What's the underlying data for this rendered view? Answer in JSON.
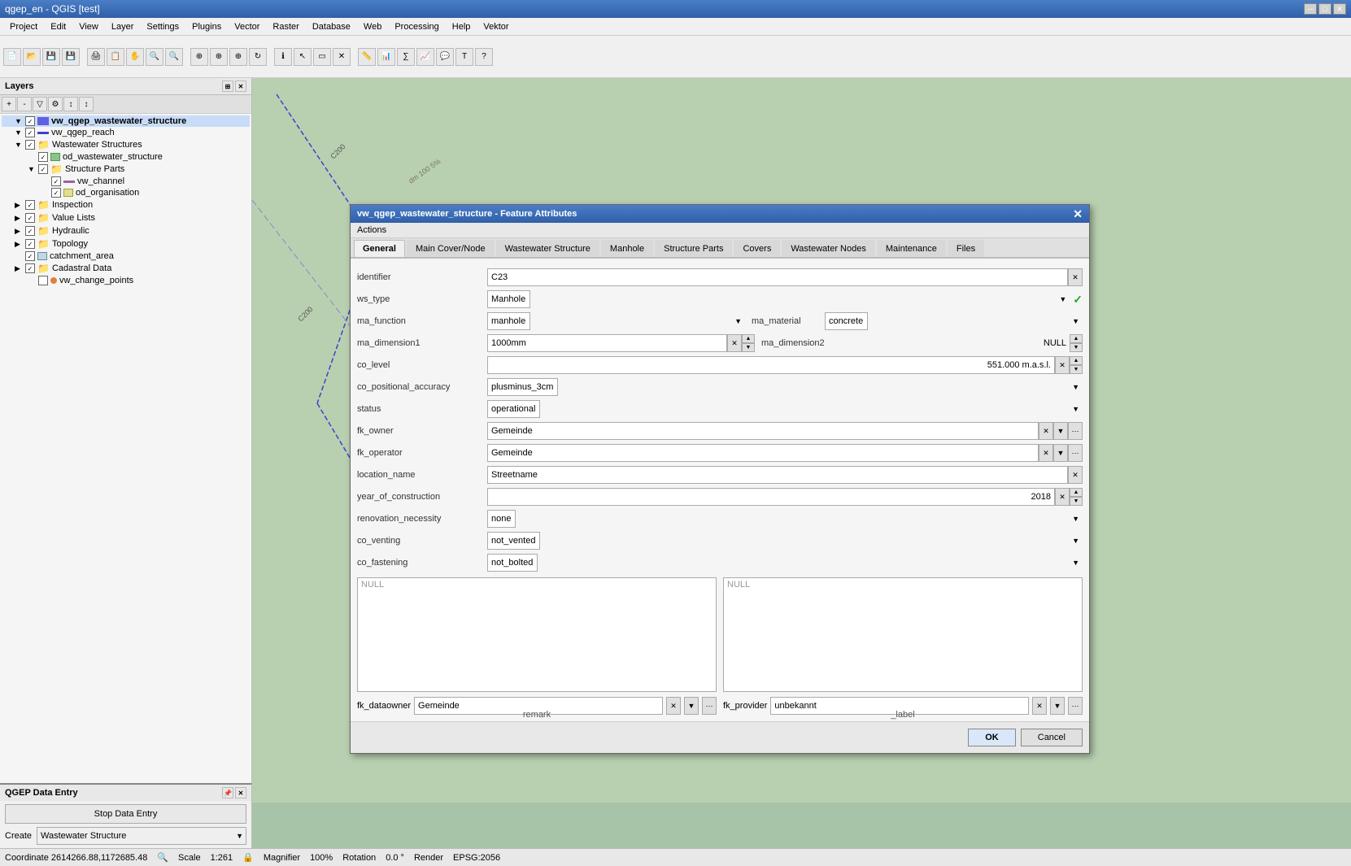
{
  "app": {
    "title": "qgep_en - QGIS [test]",
    "version": "QGIS"
  },
  "menu": {
    "items": [
      "Project",
      "Edit",
      "View",
      "Layer",
      "Settings",
      "Plugins",
      "Vector",
      "Raster",
      "Database",
      "Web",
      "Processing",
      "Help",
      "Vektor"
    ]
  },
  "layers_panel": {
    "title": "Layers",
    "items": [
      {
        "id": "vw_qgep_wastewater_structure",
        "label": "vw_qgep_wastewater_structure",
        "indent": 1,
        "checked": true,
        "bold": true
      },
      {
        "id": "vw_qgep_reach",
        "label": "vw_qgep_reach",
        "indent": 1,
        "checked": true
      },
      {
        "id": "wastewater_structures",
        "label": "Wastewater Structures",
        "indent": 1,
        "checked": true,
        "group": true
      },
      {
        "id": "od_wastewater_structure",
        "label": "od_wastewater_structure",
        "indent": 2,
        "checked": true
      },
      {
        "id": "structure_parts",
        "label": "Structure Parts",
        "indent": 2,
        "checked": true,
        "group": true
      },
      {
        "id": "vw_channel",
        "label": "vw_channel",
        "indent": 3,
        "checked": true
      },
      {
        "id": "od_organisation",
        "label": "od_organisation",
        "indent": 3,
        "checked": true
      },
      {
        "id": "inspection",
        "label": "Inspection",
        "indent": 1,
        "checked": true,
        "group": true
      },
      {
        "id": "value_lists",
        "label": "Value Lists",
        "indent": 1,
        "checked": true,
        "group": true
      },
      {
        "id": "hydraulic",
        "label": "Hydraulic",
        "indent": 1,
        "checked": true,
        "group": true
      },
      {
        "id": "topology",
        "label": "Topology",
        "indent": 1,
        "checked": true,
        "group": true
      },
      {
        "id": "catchment_area",
        "label": "catchment_area",
        "indent": 1,
        "checked": true
      },
      {
        "id": "cadastral_data",
        "label": "Cadastral Data",
        "indent": 1,
        "checked": true,
        "group": true
      },
      {
        "id": "vw_change_points",
        "label": "vw_change_points",
        "indent": 2,
        "checked": true
      }
    ]
  },
  "dialog": {
    "title": "vw_qgep_wastewater_structure - Feature Attributes",
    "actions_label": "Actions",
    "tabs": [
      "General",
      "Main Cover/Node",
      "Wastewater Structure",
      "Manhole",
      "Structure Parts",
      "Covers",
      "Wastewater Nodes",
      "Maintenance",
      "Files"
    ],
    "active_tab": "General",
    "fields": {
      "identifier_label": "identifier",
      "identifier_value": "C23",
      "ws_type_label": "ws_type",
      "ws_type_value": "Manhole",
      "ma_function_label": "ma_function",
      "ma_function_value": "manhole",
      "ma_material_label": "ma_material",
      "ma_material_value": "concrete",
      "ma_dimension1_label": "ma_dimension1",
      "ma_dimension1_value": "1000mm",
      "ma_dimension2_label": "ma_dimension2",
      "ma_dimension2_value": "NULL",
      "co_level_label": "co_level",
      "co_level_value": "551.000 m.a.s.l.",
      "co_positional_accuracy_label": "co_positional_accuracy",
      "co_positional_accuracy_value": "plusminus_3cm",
      "status_label": "status",
      "status_value": "operational",
      "fk_owner_label": "fk_owner",
      "fk_owner_value": "Gemeinde",
      "fk_operator_label": "fk_operator",
      "fk_operator_value": "Gemeinde",
      "location_name_label": "location_name",
      "location_name_value": "Streetname",
      "year_of_construction_label": "year_of_construction",
      "year_of_construction_value": "2018",
      "renovation_necessity_label": "renovation_necessity",
      "renovation_necessity_value": "none",
      "co_venting_label": "co_venting",
      "co_venting_value": "not_vented",
      "co_fastening_label": "co_fastening",
      "co_fastening_value": "not_bolted",
      "remark_label": "remark",
      "remark_null": "NULL",
      "label_label": "_label",
      "label_null": "NULL",
      "fk_dataowner_label": "fk_dataowner",
      "fk_dataowner_value": "Gemeinde",
      "fk_provider_label": "fk_provider",
      "fk_provider_value": "unbekannt"
    },
    "buttons": {
      "ok": "OK",
      "cancel": "Cancel"
    }
  },
  "data_entry": {
    "title": "QGEP Data Entry",
    "stop_button": "Stop Data Entry",
    "create_label": "Create",
    "create_value": "Wastewater Structure"
  },
  "status_bar": {
    "coordinate": "Coordinate  2614266.88,1172685.48",
    "scale_label": "Scale",
    "scale_value": "1:261",
    "magnifier_label": "Magnifier",
    "magnifier_value": "100%",
    "rotation_label": "Rotation",
    "rotation_value": "0.0 °",
    "render": "Render",
    "epsg": "EPSG:2056"
  }
}
